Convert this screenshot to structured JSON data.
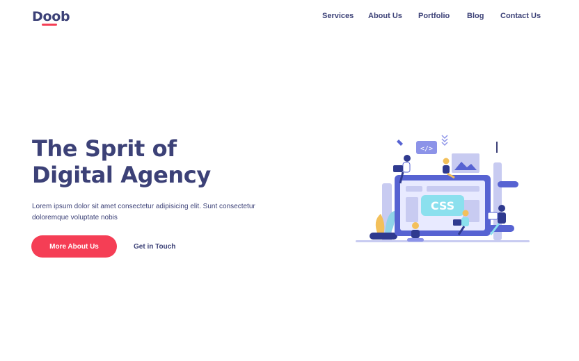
{
  "header": {
    "logo": "Doob",
    "nav": [
      "Services",
      "About Us",
      "Portfolio",
      "Blog",
      "Contact Us"
    ]
  },
  "hero": {
    "title_line1": "The Sprit of",
    "title_line2": "Digital Agency",
    "description": "Lorem ipsum dolor sit amet consectetur adipisicing elit. Sunt consectetur doloremque voluptate nobis",
    "primary_button": "More About Us",
    "secondary_link": "Get in Touch"
  },
  "illustration": {
    "screen_label": "CSS",
    "code_label": "</>"
  },
  "colors": {
    "brand": "#3c4177",
    "accent": "#f53e55",
    "illustration_primary": "#5763d2",
    "illustration_light": "#c8cbf1"
  }
}
